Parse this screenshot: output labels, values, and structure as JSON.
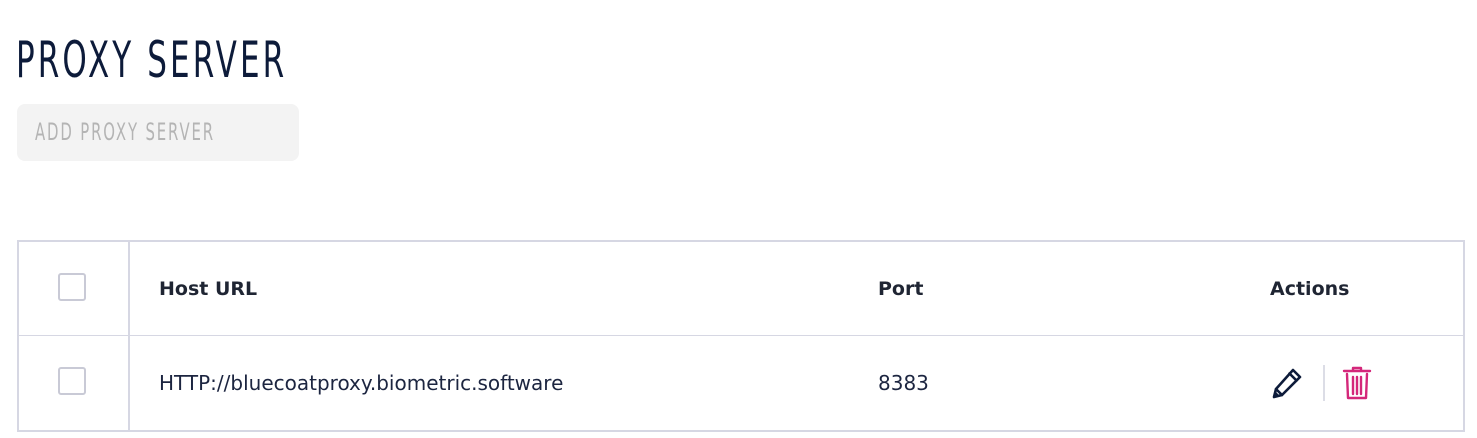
{
  "page": {
    "title": "PROXY SERVER"
  },
  "toolbar": {
    "add_label": "ADD PROXY SERVER"
  },
  "table": {
    "columns": [
      "Host URL",
      "Port",
      "Actions"
    ],
    "rows": [
      {
        "host_url": "HTTP://bluecoatproxy.biometric.software",
        "port": "8383",
        "actions": [
          "pencil-icon",
          "trash-icon"
        ]
      }
    ]
  },
  "colors": {
    "title": "#0d1b3a",
    "edit_icon": "#0d1b3a",
    "delete_icon": "#d4277a",
    "border": "#d6d7e3",
    "disabled_button_bg": "#f3f3f3",
    "disabled_button_text": "#b4b4b4"
  }
}
